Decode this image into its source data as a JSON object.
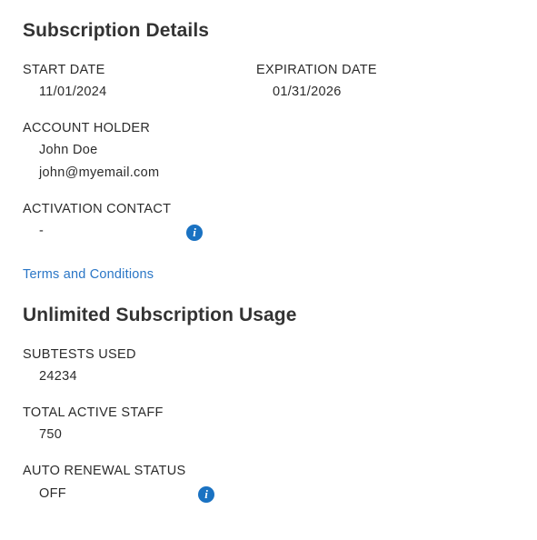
{
  "subscription_details": {
    "heading": "Subscription Details",
    "start_date": {
      "label": "START DATE",
      "value": "11/01/2024"
    },
    "expiration_date": {
      "label": "EXPIRATION DATE",
      "value": "01/31/2026"
    },
    "account_holder": {
      "label": "ACCOUNT HOLDER",
      "name": "John Doe",
      "email": "john@myemail.com"
    },
    "activation_contact": {
      "label": "ACTIVATION CONTACT",
      "value": "-",
      "info_icon": "info-icon",
      "info_glyph": "i"
    },
    "terms_link": "Terms and Conditions"
  },
  "usage": {
    "heading": "Unlimited Subscription Usage",
    "subtests_used": {
      "label": "SUBTESTS USED",
      "value": "24234"
    },
    "total_active_staff": {
      "label": "TOTAL ACTIVE STAFF",
      "value": "750"
    },
    "auto_renewal_status": {
      "label": "AUTO RENEWAL STATUS",
      "value": "OFF",
      "info_icon": "info-icon",
      "info_glyph": "i"
    }
  },
  "colors": {
    "link": "#2a76c6",
    "info_icon": "#1a72c2",
    "heading": "#333333",
    "text": "#2b2b2b"
  }
}
